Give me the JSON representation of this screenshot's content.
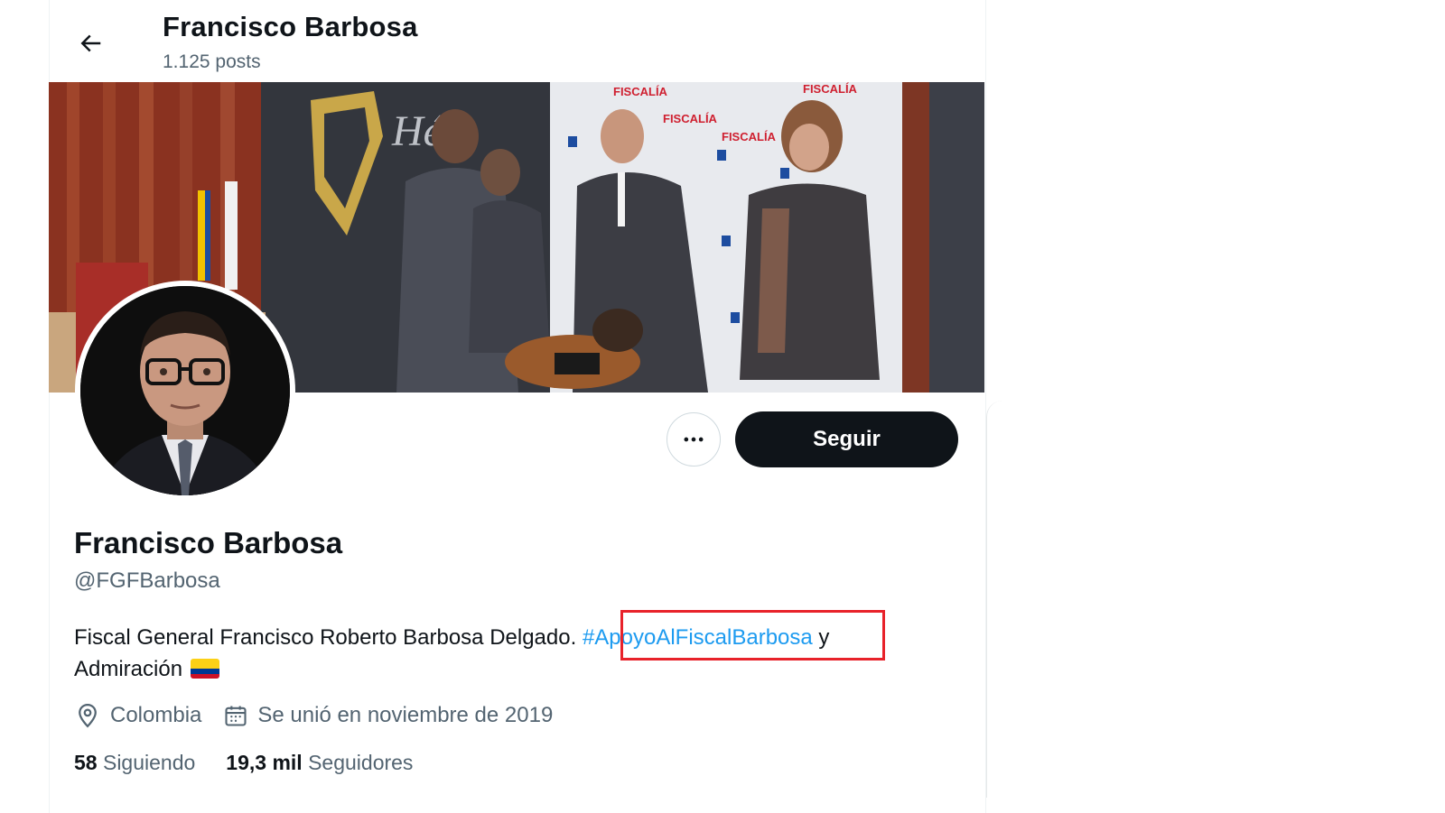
{
  "header": {
    "name": "Francisco Barbosa",
    "posts_count": "1.125 posts"
  },
  "icons": {
    "back": "arrow-left-icon",
    "more": "more-horizontal-icon",
    "location": "location-pin-icon",
    "calendar": "calendar-icon"
  },
  "banner": {
    "logo_text": "Hé",
    "brand_text": "FISCALÍA"
  },
  "actions": {
    "follow_label": "Seguir"
  },
  "profile": {
    "display_name": "Francisco Barbosa",
    "handle": "@FGFBarbosa",
    "bio_before": "Fiscal General Francisco Roberto Barbosa Delgado. ",
    "bio_hashtag": "#ApoyoAlFiscalBarbosa",
    "bio_after": " y Admiración",
    "location": "Colombia",
    "joined": "Se unió en noviembre de 2019"
  },
  "stats": {
    "following_count": "58",
    "following_label": "Siguiendo",
    "followers_count": "19,3 mil",
    "followers_label": "Seguidores"
  },
  "colors": {
    "link": "#1d9bf0",
    "follow_button": "#0f1419",
    "secondary_text": "#536471",
    "highlight": "#e8222a"
  }
}
